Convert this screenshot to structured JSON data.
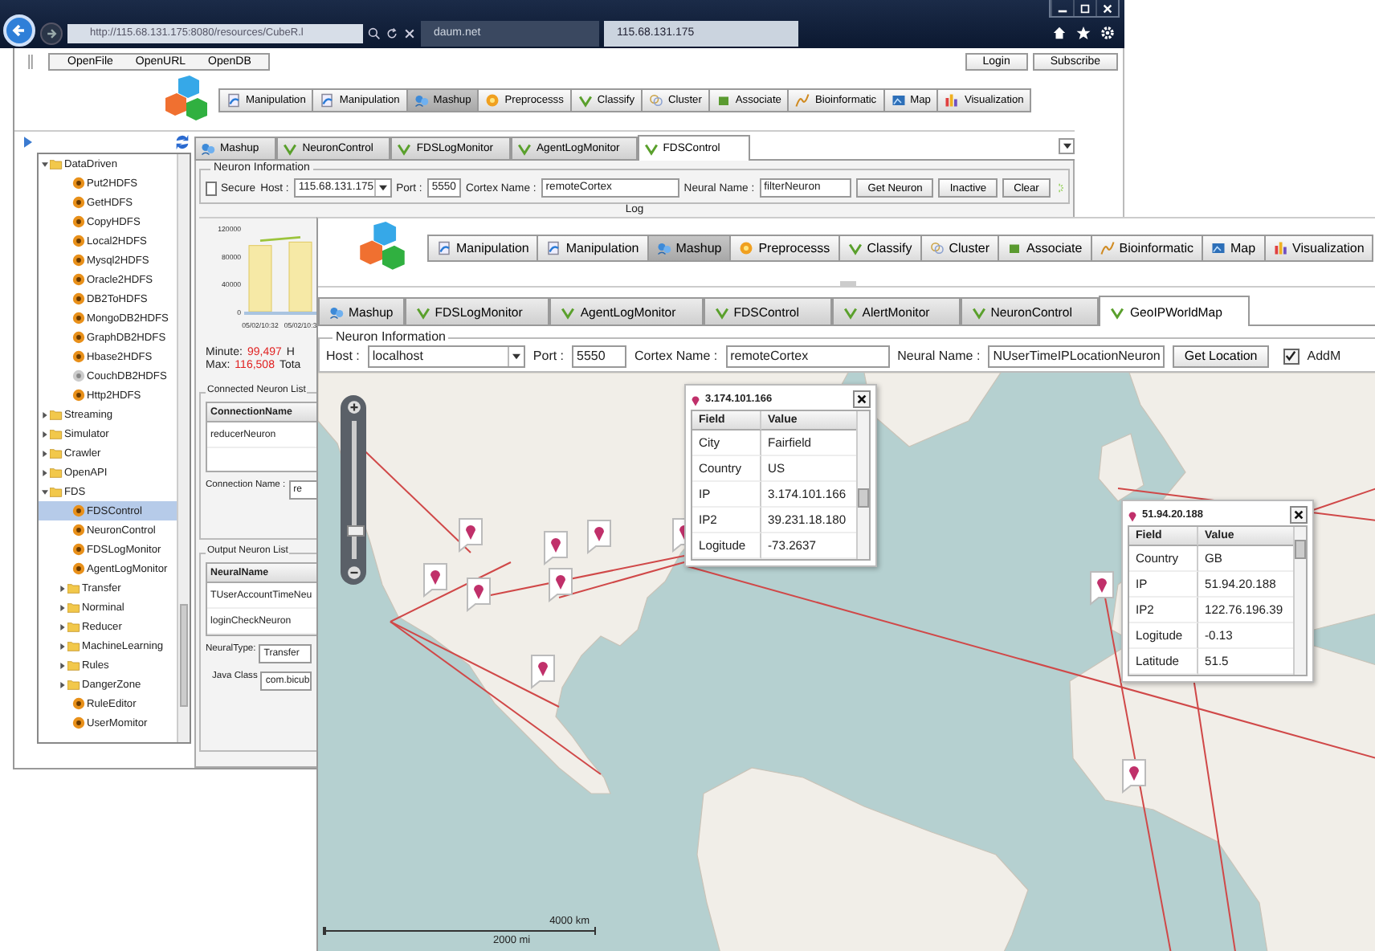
{
  "browser": {
    "address": "http://115.68.131.175:8080/resources/CubeR.l",
    "tabs": [
      {
        "label": "daum.net",
        "selected": false
      },
      {
        "label": "115.68.131.175",
        "selected": true
      }
    ]
  },
  "back_window": {
    "menu": [
      "OpenFile",
      "OpenURL",
      "OpenDB"
    ],
    "account_buttons": [
      "Login",
      "Subscribe"
    ],
    "toolbar": [
      {
        "label": "Manipulation",
        "selected": false
      },
      {
        "label": "Manipulation",
        "selected": false
      },
      {
        "label": "Mashup",
        "selected": true
      },
      {
        "label": "Preprocesss",
        "selected": false
      },
      {
        "label": "Classify",
        "selected": false
      },
      {
        "label": "Cluster",
        "selected": false
      },
      {
        "label": "Associate",
        "selected": false
      },
      {
        "label": "Bioinformatic",
        "selected": false
      },
      {
        "label": "Map",
        "selected": false
      },
      {
        "label": "Visualization",
        "selected": false
      }
    ],
    "tree": [
      {
        "label": "DataDriven",
        "kind": "folder",
        "expanded": true,
        "selected": false,
        "children": [
          {
            "label": "Put2HDFS",
            "kind": "neuron",
            "selected": false
          },
          {
            "label": "GetHDFS",
            "kind": "neuron",
            "selected": false
          },
          {
            "label": "CopyHDFS",
            "kind": "neuron",
            "selected": false
          },
          {
            "label": "Local2HDFS",
            "kind": "neuron",
            "selected": false
          },
          {
            "label": "Mysql2HDFS",
            "kind": "neuron",
            "selected": false
          },
          {
            "label": "Oracle2HDFS",
            "kind": "neuron",
            "selected": false
          },
          {
            "label": "DB2ToHDFS",
            "kind": "neuron",
            "selected": false
          },
          {
            "label": "MongoDB2HDFS",
            "kind": "neuron",
            "selected": false
          },
          {
            "label": "GraphDB2HDFS",
            "kind": "neuron",
            "selected": false
          },
          {
            "label": "Hbase2HDFS",
            "kind": "neuron",
            "selected": false
          },
          {
            "label": "CouchDB2HDFS",
            "kind": "idle",
            "selected": false
          },
          {
            "label": "Http2HDFS",
            "kind": "neuron",
            "selected": false
          }
        ]
      },
      {
        "label": "Streaming",
        "kind": "folder",
        "expanded": false,
        "selected": false
      },
      {
        "label": "Simulator",
        "kind": "folder",
        "expanded": false,
        "selected": false
      },
      {
        "label": "Crawler",
        "kind": "folder",
        "expanded": false,
        "selected": false
      },
      {
        "label": "OpenAPI",
        "kind": "folder",
        "expanded": false,
        "selected": false
      },
      {
        "label": "FDS",
        "kind": "folder",
        "expanded": true,
        "selected": false,
        "children": [
          {
            "label": "FDSControl",
            "kind": "neuron",
            "selected": true
          },
          {
            "label": "NeuronControl",
            "kind": "neuron",
            "selected": false
          },
          {
            "label": "FDSLogMonitor",
            "kind": "neuron",
            "selected": false
          },
          {
            "label": "AgentLogMonitor",
            "kind": "neuron",
            "selected": false
          },
          {
            "label": "Transfer",
            "kind": "folder",
            "expanded": false,
            "selected": false
          },
          {
            "label": "Norminal",
            "kind": "folder",
            "expanded": false,
            "selected": false
          },
          {
            "label": "Reducer",
            "kind": "folder",
            "expanded": false,
            "selected": false
          },
          {
            "label": "MachineLearning",
            "kind": "folder",
            "expanded": false,
            "selected": false
          },
          {
            "label": "Rules",
            "kind": "folder",
            "expanded": false,
            "selected": false
          },
          {
            "label": "DangerZone",
            "kind": "folder",
            "expanded": false,
            "selected": false
          },
          {
            "label": "RuleEditor",
            "kind": "neuron",
            "selected": false
          },
          {
            "label": "UserMomitor",
            "kind": "neuron",
            "selected": false
          }
        ]
      }
    ],
    "tabs": [
      {
        "label": "Mashup",
        "selected": false
      },
      {
        "label": "NeuronControl",
        "selected": false
      },
      {
        "label": "FDSLogMonitor",
        "selected": false
      },
      {
        "label": "AgentLogMonitor",
        "selected": false
      },
      {
        "label": "FDSControl",
        "selected": true
      }
    ],
    "neuron_info": {
      "title": "Neuron Information",
      "secure_label": "Secure",
      "secure_checked": false,
      "host_label": "Host :",
      "host": "115.68.131.175",
      "port_label": "Port :",
      "port": "5550",
      "cortex_label": "Cortex Name :",
      "cortex": "remoteCortex",
      "neural_label": "Neural Name :",
      "neural": "filterNeuron",
      "buttons": [
        "Get Neuron",
        "Inactive",
        "Clear"
      ]
    },
    "log_title": "Log",
    "chart_data": {
      "type": "bar",
      "categories": [
        "05/02/10:32",
        "05/02/10:3"
      ],
      "values": [
        95000,
        100000
      ],
      "ylim": [
        0,
        120000
      ],
      "yticks": [
        0,
        40000,
        80000,
        120000
      ]
    },
    "stats": [
      {
        "label": "Minute:",
        "value": "99,497",
        "next": "H"
      },
      {
        "label": "Max:",
        "value": "116,508",
        "next": "Tota"
      }
    ],
    "connected": {
      "title": "Connected Neuron List",
      "column": "ConnectionName",
      "rows": [
        "reducerNeuron"
      ],
      "field_label": "Connection Name :",
      "field_value": "re"
    },
    "output": {
      "title": "Output Neuron List",
      "column": "NeuralName",
      "rows": [
        "TUserAccountTimeNeu",
        "loginCheckNeuron"
      ],
      "type_label": "NeuralType:",
      "type_value": "Transfer",
      "class_label": "Java Class",
      "class_value": "com.bicub"
    }
  },
  "front_window": {
    "toolbar": [
      {
        "label": "Manipulation",
        "selected": false
      },
      {
        "label": "Manipulation",
        "selected": false
      },
      {
        "label": "Mashup",
        "selected": true
      },
      {
        "label": "Preprocesss",
        "selected": false
      },
      {
        "label": "Classify",
        "selected": false
      },
      {
        "label": "Cluster",
        "selected": false
      },
      {
        "label": "Associate",
        "selected": false
      },
      {
        "label": "Bioinformatic",
        "selected": false
      },
      {
        "label": "Map",
        "selected": false
      },
      {
        "label": "Visualization",
        "selected": false
      }
    ],
    "tabs": [
      {
        "label": "Mashup",
        "selected": false
      },
      {
        "label": "FDSLogMonitor",
        "selected": false
      },
      {
        "label": "AgentLogMonitor",
        "selected": false
      },
      {
        "label": "FDSControl",
        "selected": false
      },
      {
        "label": "AlertMonitor",
        "selected": false
      },
      {
        "label": "NeuronControl",
        "selected": false
      },
      {
        "label": "GeoIPWorldMap",
        "selected": true
      }
    ],
    "neuron_info": {
      "title": "Neuron Information",
      "host_label": "Host :",
      "host": "localhost",
      "port_label": "Port :",
      "port": "5550",
      "cortex_label": "Cortex Name :",
      "cortex": "remoteCortex",
      "neural_label": "Neural Name :",
      "neural": "NUserTimeIPLocationNeuron",
      "button": "Get Location",
      "add_label": "AddM",
      "add_checked": true
    },
    "map": {
      "zoom": {
        "level": 0.2
      },
      "scale": {
        "km": "4000 km",
        "mi": "2000 mi"
      },
      "popups": [
        {
          "title": "3.174.101.166",
          "columns": [
            "Field",
            "Value"
          ],
          "rows": [
            {
              "field": "City",
              "value": "Fairfield"
            },
            {
              "field": "Country",
              "value": "US"
            },
            {
              "field": "IP",
              "value": "3.174.101.166"
            },
            {
              "field": "IP2",
              "value": "39.231.18.180"
            },
            {
              "field": "Logitude",
              "value": "-73.2637"
            }
          ]
        },
        {
          "title": "51.94.20.188",
          "columns": [
            "Field",
            "Value"
          ],
          "rows": [
            {
              "field": "Country",
              "value": "GB"
            },
            {
              "field": "IP",
              "value": "51.94.20.188"
            },
            {
              "field": "IP2",
              "value": "122.76.196.39"
            },
            {
              "field": "Logitude",
              "value": "-0.13"
            },
            {
              "field": "Latitude",
              "value": "51.5"
            }
          ]
        }
      ]
    }
  }
}
